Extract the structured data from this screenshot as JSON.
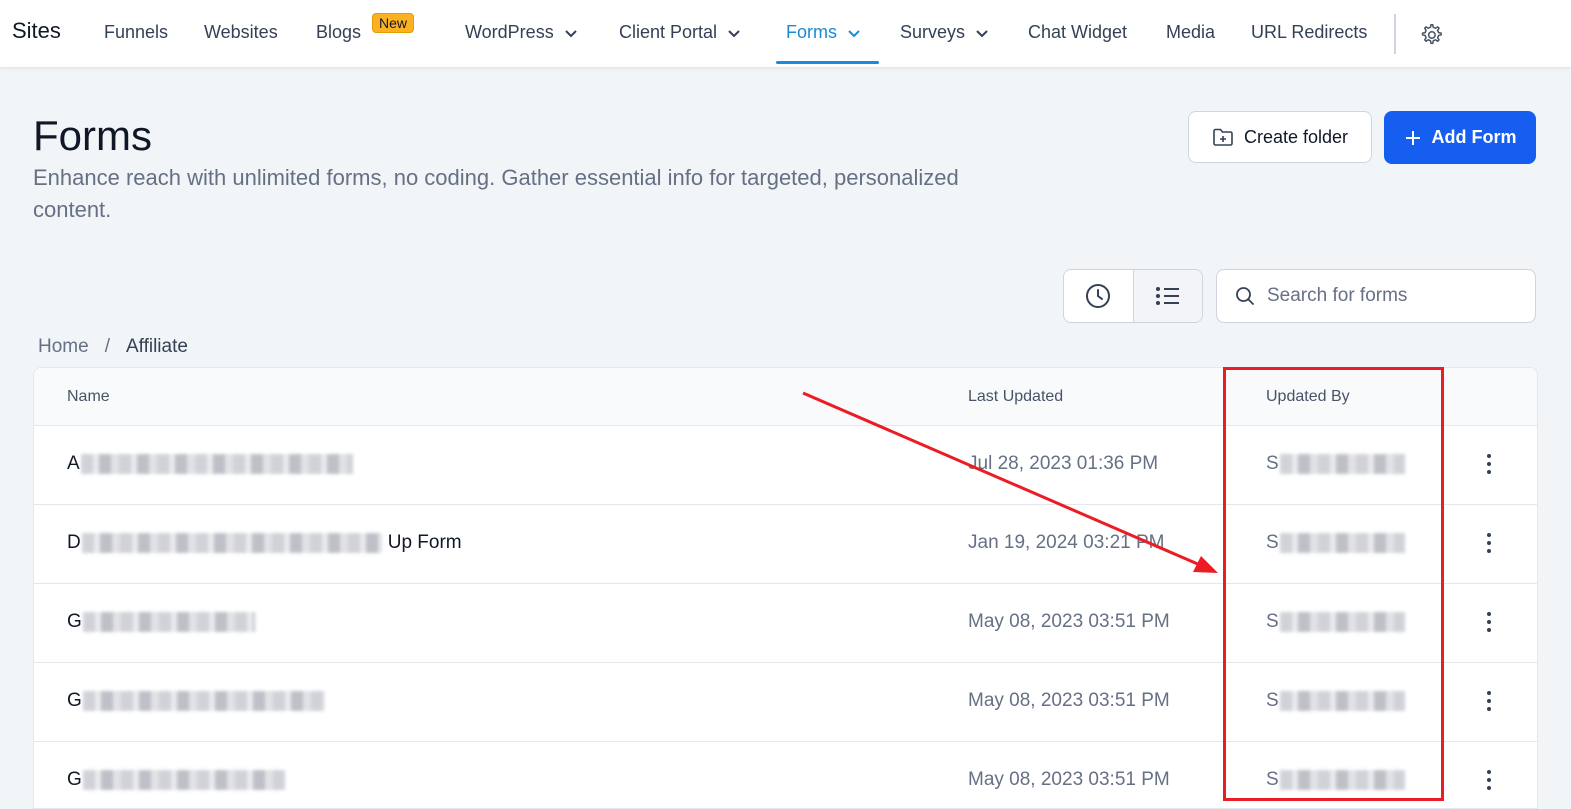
{
  "nav": {
    "brand": "Sites",
    "items": [
      {
        "label": "Funnels"
      },
      {
        "label": "Websites"
      },
      {
        "label": "Blogs",
        "badge": "New"
      },
      {
        "label": "WordPress",
        "icon": "chevron-down-icon"
      },
      {
        "label": "Client Portal",
        "icon": "chevron-down-icon"
      },
      {
        "label": "Forms",
        "icon": "chevron-down-icon",
        "active": true
      },
      {
        "label": "Surveys",
        "icon": "chevron-down-icon"
      },
      {
        "label": "Chat Widget"
      },
      {
        "label": "Media"
      },
      {
        "label": "URL Redirects"
      }
    ],
    "settings_icon": "gear-icon",
    "active_color": "#1a8bd6"
  },
  "header": {
    "title": "Forms",
    "description": "Enhance reach with unlimited forms, no coding. Gather essential info for targeted, personalized content.",
    "create_folder_label": "Create folder",
    "create_folder_icon": "folder-plus-icon",
    "add_form_label": "Add Form",
    "add_form_icon": "plus-icon",
    "primary_color": "#155eef"
  },
  "toolbar": {
    "recent_icon": "clock-icon",
    "list_icon": "list-icon",
    "search_placeholder": "Search for forms",
    "search_icon": "search-icon"
  },
  "breadcrumb": {
    "home": "Home",
    "separator": "/",
    "current": "Affiliate"
  },
  "table": {
    "columns": [
      "Name",
      "Last Updated",
      "Updated By"
    ],
    "rows": [
      {
        "name_prefix": "A",
        "name_suffix": "",
        "last_updated": "Jul 28, 2023 01:36 PM",
        "updated_by_prefix": "S"
      },
      {
        "name_prefix": "D",
        "name_suffix": "Up Form",
        "last_updated": "Jan 19, 2024 03:21 PM",
        "updated_by_prefix": "S"
      },
      {
        "name_prefix": "G",
        "name_suffix": "",
        "last_updated": "May 08, 2023 03:51 PM",
        "updated_by_prefix": "S"
      },
      {
        "name_prefix": "G",
        "name_suffix": "",
        "last_updated": "May 08, 2023 03:51 PM",
        "updated_by_prefix": "S"
      },
      {
        "name_prefix": "G",
        "name_suffix": "",
        "last_updated": "May 08, 2023 03:51 PM",
        "updated_by_prefix": "S"
      }
    ],
    "row_menu_icon": "kebab-menu-icon"
  },
  "annotation": {
    "color": "#ec1c24",
    "highlights_column": "Updated By"
  }
}
